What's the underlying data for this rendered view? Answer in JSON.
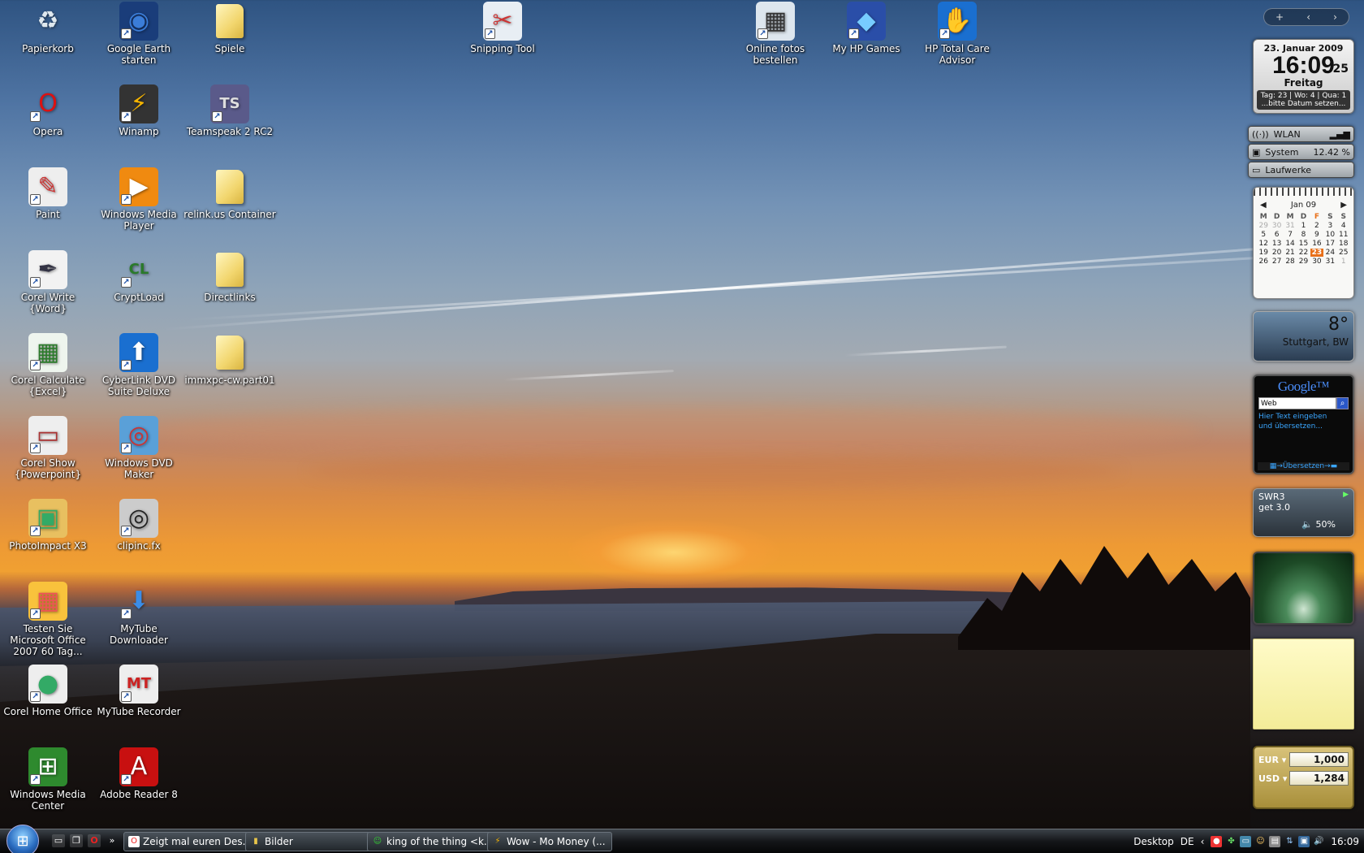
{
  "desktop_icons": [
    {
      "label": "Papierkorb",
      "icon": "recycle-bin-icon",
      "shortcut": false
    },
    {
      "label": "Google Earth starten",
      "icon": "google-earth-icon",
      "shortcut": true
    },
    {
      "label": "Spiele",
      "icon": "folder-icon",
      "shortcut": false
    },
    {
      "label": "Snipping Tool",
      "icon": "scissors-icon",
      "shortcut": true
    },
    {
      "label": "Online fotos bestellen",
      "icon": "photos-icon",
      "shortcut": true
    },
    {
      "label": "My HP Games",
      "icon": "hp-games-icon",
      "shortcut": true
    },
    {
      "label": "HP Total Care Advisor",
      "icon": "hp-advisor-icon",
      "shortcut": true
    },
    {
      "label": "Opera",
      "icon": "opera-icon",
      "shortcut": true
    },
    {
      "label": "Winamp",
      "icon": "winamp-icon",
      "shortcut": true
    },
    {
      "label": "Teamspeak 2 RC2",
      "icon": "teamspeak-icon",
      "shortcut": true
    },
    {
      "label": "Paint",
      "icon": "paint-icon",
      "shortcut": true
    },
    {
      "label": "Windows Media Player",
      "icon": "media-player-icon",
      "shortcut": true
    },
    {
      "label": "relink.us Container",
      "icon": "folder-icon",
      "shortcut": false
    },
    {
      "label": "Corel Write {Word}",
      "icon": "corel-write-icon",
      "shortcut": true
    },
    {
      "label": "CryptLoad",
      "icon": "cryptload-icon",
      "shortcut": true
    },
    {
      "label": "Directlinks",
      "icon": "folder-icon",
      "shortcut": false
    },
    {
      "label": "Corel Calculate {Excel}",
      "icon": "corel-calculate-icon",
      "shortcut": true
    },
    {
      "label": "CyberLink DVD Suite Deluxe",
      "icon": "cyberlink-icon",
      "shortcut": true
    },
    {
      "label": "immxpc-cw.part01",
      "icon": "folder-icon",
      "shortcut": false
    },
    {
      "label": "Corel Show {Powerpoint}",
      "icon": "corel-show-icon",
      "shortcut": true
    },
    {
      "label": "Windows DVD Maker",
      "icon": "dvd-maker-icon",
      "shortcut": true
    },
    {
      "label": "PhotoImpact X3",
      "icon": "photoimpact-icon",
      "shortcut": true
    },
    {
      "label": "clipinc.fx",
      "icon": "clipinc-icon",
      "shortcut": true
    },
    {
      "label": "Testen Sie Microsoft Office 2007 60 Tag...",
      "icon": "office-icon",
      "shortcut": true
    },
    {
      "label": "MyTube Downloader",
      "icon": "download-arrow-icon",
      "shortcut": true
    },
    {
      "label": "Corel Home Office",
      "icon": "corel-home-icon",
      "shortcut": true
    },
    {
      "label": "MyTube Recorder",
      "icon": "mytube-recorder-icon",
      "shortcut": true
    },
    {
      "label": "Windows Media Center",
      "icon": "media-center-icon",
      "shortcut": true
    },
    {
      "label": "Adobe Reader 8",
      "icon": "adobe-reader-icon",
      "shortcut": true
    }
  ],
  "sidebar": {
    "clock": {
      "date": "23. Januar 2009",
      "time": "16:09",
      "seconds": "25",
      "weekday": "Freitag",
      "info_line1": "Tag: 23 |  Wo: 4 |   Qua: 1",
      "info_line2": "...bitte Datum setzen..."
    },
    "meters": [
      {
        "label": "WLAN",
        "value": "",
        "icon": "wifi-icon"
      },
      {
        "label": "System",
        "value": "12.42 %",
        "icon": "cpu-icon"
      },
      {
        "label": "Laufwerke",
        "value": "",
        "icon": "drive-icon"
      }
    ],
    "calendar": {
      "month": "Jan 09",
      "headers": [
        "M",
        "D",
        "M",
        "D",
        "F",
        "S",
        "S"
      ],
      "weeks": [
        [
          "29",
          "30",
          "31",
          "1",
          "2",
          "3",
          "4"
        ],
        [
          "5",
          "6",
          "7",
          "8",
          "9",
          "10",
          "11"
        ],
        [
          "12",
          "13",
          "14",
          "15",
          "16",
          "17",
          "18"
        ],
        [
          "19",
          "20",
          "21",
          "22",
          "23",
          "24",
          "25"
        ],
        [
          "26",
          "27",
          "28",
          "29",
          "30",
          "31",
          "1"
        ]
      ],
      "today": "23"
    },
    "weather": {
      "temp": "8°",
      "city": "Stuttgart, BW"
    },
    "google": {
      "logo": "Google™",
      "search_value": "Web",
      "hint": "Hier Text eingeben und übersetzen...",
      "translate": "Übersetzen"
    },
    "radio": {
      "station": "SWR3",
      "title": "get 3.0",
      "volume": "50%"
    },
    "currency": [
      {
        "code": "EUR",
        "amount": "1,000"
      },
      {
        "code": "USD",
        "amount": "1,284"
      }
    ]
  },
  "taskbar": {
    "tasks": [
      {
        "label": "Zeigt mal euren Des...",
        "icon": "opera-icon"
      },
      {
        "label": "Bilder",
        "icon": "folder-icon"
      },
      {
        "label": "king of the thing <k...",
        "icon": "messenger-icon"
      },
      {
        "label": "Wow - Mo Money (...",
        "icon": "winamp-icon"
      }
    ],
    "desktop_label": "Desktop",
    "language": "DE",
    "clock": "16:09"
  },
  "colors": {
    "taskbar": "#141619",
    "calendar_today": "#e8701a",
    "google_link": "#3aa6ff"
  }
}
